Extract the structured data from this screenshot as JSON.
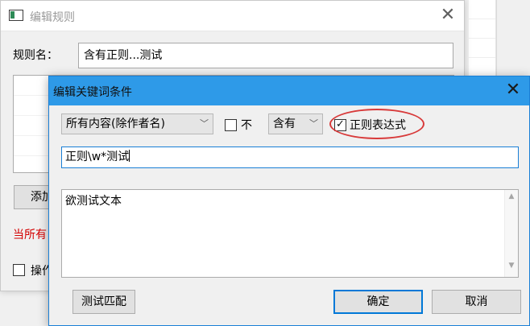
{
  "background_window": {},
  "rule_window": {
    "title": "编辑规则",
    "close_glyph": "✕",
    "rule_name_label": "规则名：",
    "rule_name_value": "含有正则...测试",
    "add_button_label": "添加",
    "warning_text": "当所有",
    "operation_label": "操作"
  },
  "dialog": {
    "title": "编辑关键词条件",
    "close_glyph": "✕",
    "scope_select": {
      "selected": "所有内容(除作者名)"
    },
    "not_checkbox": {
      "label": "不",
      "checked": false
    },
    "op_select": {
      "selected": "含有"
    },
    "regex_checkbox": {
      "label": "正则表达式",
      "checked": true,
      "check_glyph": "✓"
    },
    "pattern_value": "正则\\w*测试",
    "test_text": "欲测试文本",
    "test_button_label": "测试匹配",
    "ok_button_label": "确定",
    "cancel_button_label": "取消"
  },
  "icons": {
    "chevron": "﹀",
    "scroll_up": "▲",
    "scroll_down": "▼"
  },
  "colors": {
    "dialog_title_bar": "#2e9ae8",
    "accent_border": "#1a7fd6",
    "highlight_ellipse": "#d83a3a",
    "warning_text": "#d40000"
  }
}
